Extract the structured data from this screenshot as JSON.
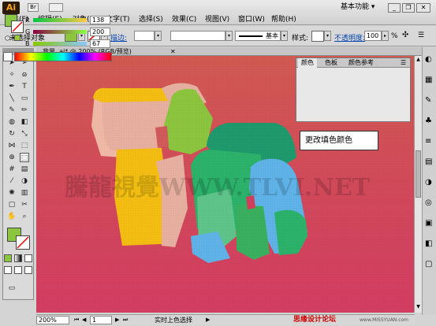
{
  "app": {
    "logo": "Ai",
    "workspace": "基本功能",
    "window_title": "Adobe Illustrator"
  },
  "menu": [
    "文件(F)",
    "编辑(E)",
    "对象(O)",
    "文字(T)",
    "选择(S)",
    "效果(C)",
    "视图(V)",
    "窗口(W)",
    "帮助(H)"
  ],
  "control": {
    "selection_label": "未选择对象",
    "stroke_label": "描边:",
    "brush_label": "基本",
    "style_label": "样式:",
    "opacity_label": "不透明度:",
    "opacity_value": "100",
    "opacity_unit": "%",
    "fill_color": "#8cc63f"
  },
  "document_tab": "背景. ai* @ 200% (RGB/预览)",
  "color_panel": {
    "tabs": [
      "颜色",
      "色板",
      "颜色参考"
    ],
    "channels": [
      {
        "label": "R",
        "value": "138"
      },
      {
        "label": "G",
        "value": "200"
      },
      {
        "label": "B",
        "value": "67"
      }
    ],
    "fill_color": "#8ac843"
  },
  "tooltip": "更改填色颜色",
  "watermark": "騰龍視覺WWW.TLVI.NET",
  "status": {
    "zoom": "200%",
    "page": "1",
    "tool": "实时上色选择",
    "credit": "思缘设计论坛",
    "credit_url": "www.MISSYUAN.com"
  }
}
